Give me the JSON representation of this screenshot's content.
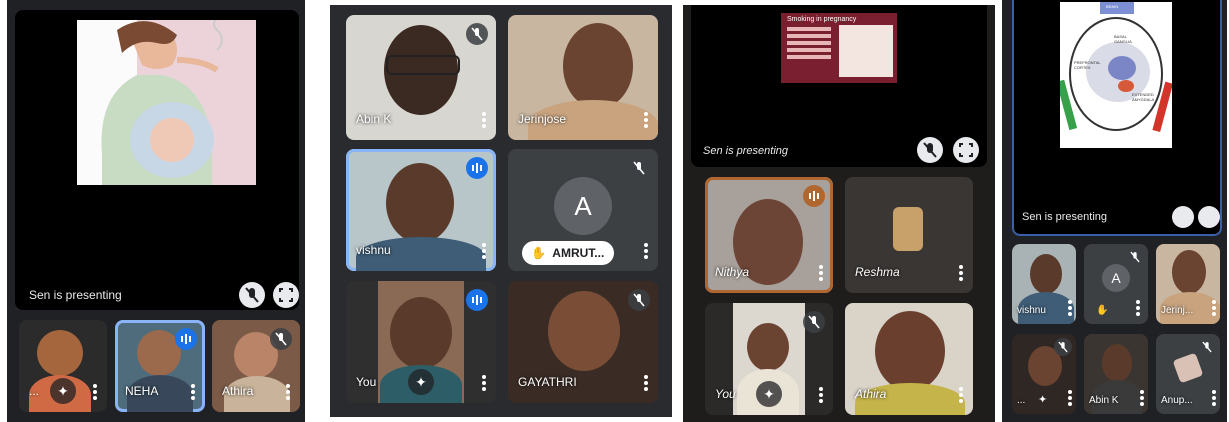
{
  "panel1": {
    "presenting_label": "Sen is presenting",
    "tiles": [
      {
        "name": "..."
      },
      {
        "name": "NEHA"
      },
      {
        "name": "Athira"
      }
    ]
  },
  "panel2": {
    "tiles": [
      {
        "name": "Abin K"
      },
      {
        "name": "Jerinjose"
      },
      {
        "name": "vishnu"
      },
      {
        "name": "AMRUT...",
        "initial": "A"
      },
      {
        "name": "You"
      },
      {
        "name": "GAYATHRI"
      }
    ]
  },
  "panel3": {
    "presenting_label": "Sen is presenting",
    "slide_title": "Smoking in pregnancy",
    "tiles": [
      {
        "name": "Nithya"
      },
      {
        "name": "Reshma"
      },
      {
        "name": "You"
      },
      {
        "name": "Athira"
      }
    ]
  },
  "panel4": {
    "presenting_label": "Sen is presenting",
    "slide_labels": {
      "top": "BRAIN",
      "ganglia": "BASAL GANGLIA",
      "prefrontal": "PREFRONTAL CORTEX",
      "amygdala": "EXTENDED AMYGDALA"
    },
    "tiles": [
      {
        "name": "vishnu"
      },
      {
        "name": "",
        "initial": "A"
      },
      {
        "name": "Jerinj..."
      },
      {
        "name": "..."
      },
      {
        "name": "Abin K"
      },
      {
        "name": "Anup..."
      }
    ]
  }
}
